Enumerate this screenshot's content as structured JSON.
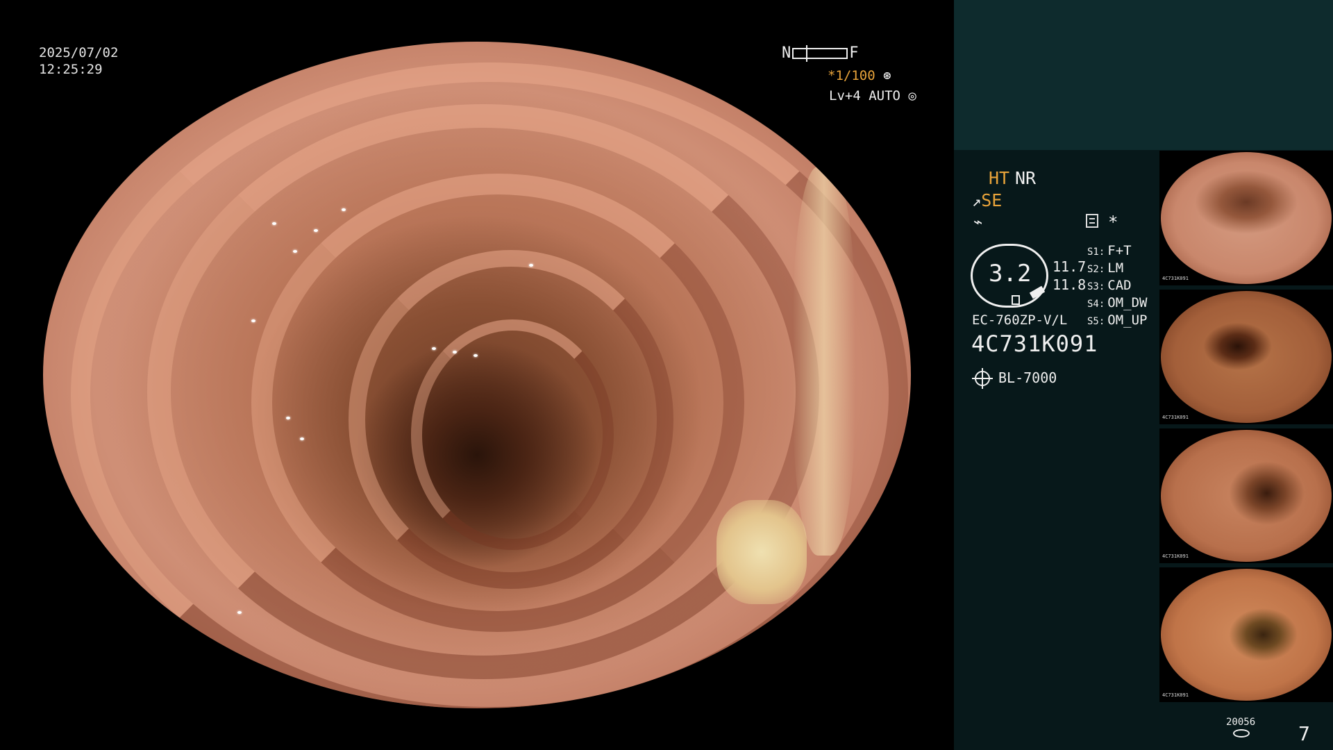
{
  "overlay": {
    "date": "2025/07/02",
    "time": "12:25:29",
    "focus_near": "N",
    "focus_far": "F",
    "shutter_prefix": "*",
    "shutter": "1/100",
    "shutter_icon": "aperture-icon",
    "level": "Lv+4 AUTO",
    "level_icon": "iris-icon"
  },
  "modes": {
    "ht": "HT",
    "nr": "NR",
    "se": "SE",
    "se_icon": "se-enhance-icon",
    "third_icon": "lightning-icon",
    "menu_icon": "menu-list-icon",
    "star": "*"
  },
  "dial": {
    "value": "3.2",
    "reading_a": "11.7",
    "reading_b": "11.8"
  },
  "scope_settings": [
    {
      "key": "S1:",
      "value": "F+T"
    },
    {
      "key": "S2:",
      "value": "LM"
    },
    {
      "key": "S3:",
      "value": "CAD"
    },
    {
      "key": "S4:",
      "value": "OM_DW"
    },
    {
      "key": "S5:",
      "value": "OM_UP"
    }
  ],
  "scope": {
    "model": "EC-760ZP-V/L",
    "serial": "4C731K091",
    "light_source": "BL-7000",
    "light_icon": "light-source-icon"
  },
  "thumbnails": [
    {
      "label": "4C731K091"
    },
    {
      "label": "4C731K091"
    },
    {
      "label": "4C731K091"
    },
    {
      "label": "4C731K091"
    }
  ],
  "footer": {
    "storage_count": "20056",
    "storage_icon": "storage-disk-icon",
    "image_count": "7"
  },
  "colors": {
    "accent_orange": "#e8a33a",
    "panel_top": "#0e2b2d",
    "panel_bottom": "#07181a"
  }
}
